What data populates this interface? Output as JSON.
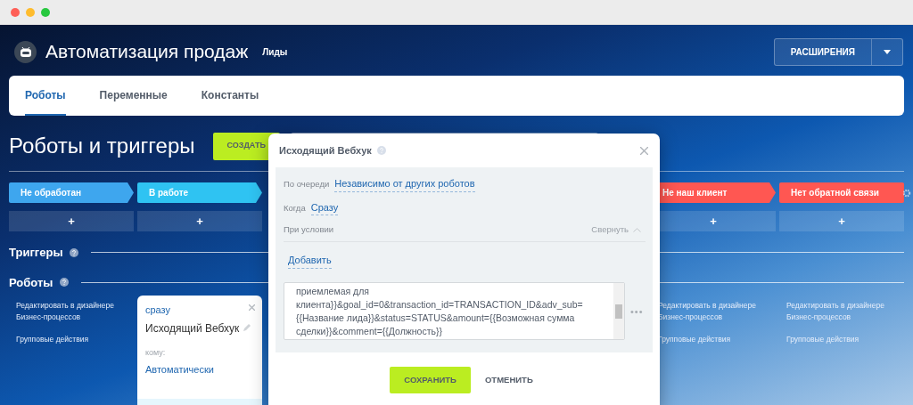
{
  "header": {
    "title": "Автоматизация продаж",
    "subtitle": "Лиды",
    "menu_button": "РАСШИРЕНИЯ"
  },
  "tabs": [
    {
      "label": "Роботы",
      "selected": true
    },
    {
      "label": "Переменные",
      "selected": false
    },
    {
      "label": "Константы",
      "selected": false
    }
  ],
  "page_title": "Роботы и триггеры",
  "create_button": "СОЗДАТЬ",
  "columns": [
    {
      "stage": "Не обработан",
      "color": "#3ea6ee",
      "add": "+",
      "links": [
        "Редактировать в дизайнере Бизнес-процессов",
        "Групповые действия"
      ]
    },
    {
      "stage": "В работе",
      "color": "#2fc3f2",
      "add": "+",
      "robot": {
        "when": "сразу",
        "name": "Исходящий Вебхук",
        "to_label": "кому:",
        "to_value": "Автоматически"
      }
    },
    {
      "stage": "Не наш клиент",
      "color": "#ff5752",
      "add": "+",
      "links": [
        "Редактировать в дизайнере Бизнес-процессов",
        "Групповые действия"
      ]
    },
    {
      "stage": "Нет обратной связи",
      "color": "#ff5752",
      "add": "+",
      "links": [
        "Редактировать в дизайнере Бизнес-процессов",
        "Групповые действия"
      ]
    }
  ],
  "sections": [
    {
      "title": "Триггеры"
    },
    {
      "title": "Роботы"
    }
  ],
  "dialog": {
    "title": "Исходящий Вебхук",
    "order_label": "По очереди",
    "order_value": "Независимо от других роботов",
    "when_label": "Когда",
    "when_value": "Сразу",
    "condition_label": "При условии",
    "collapse": "Свернуть",
    "add": "Добавить",
    "code": "приемлемая для клиента}}&goal_id=0&transaction_id=TRANSACTION_ID&adv_sub={{Название лида}}&status=STATUS&amount={{Возможная сумма сделки}}&comment={{Должность}}",
    "more": "•••",
    "save": "СОХРАНИТЬ",
    "cancel": "ОТМЕНИТЬ"
  }
}
